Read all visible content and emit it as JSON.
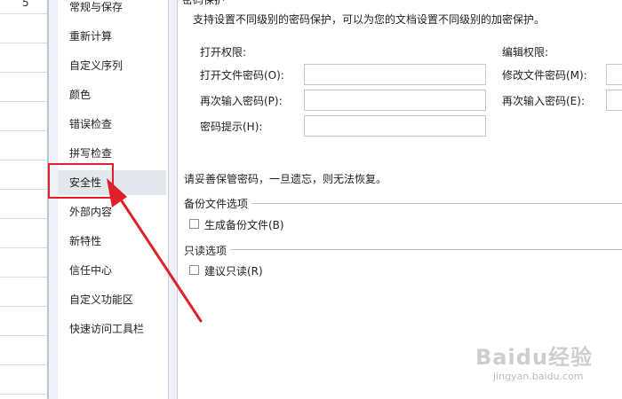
{
  "sheet": {
    "row_value": "5"
  },
  "nav": {
    "items": [
      {
        "label": "常规与保存"
      },
      {
        "label": "重新计算"
      },
      {
        "label": "自定义序列"
      },
      {
        "label": "颜色"
      },
      {
        "label": "错误检查"
      },
      {
        "label": "拼写检查"
      },
      {
        "label": "安全性"
      },
      {
        "label": "外部内容"
      },
      {
        "label": "新特性"
      },
      {
        "label": "信任中心"
      },
      {
        "label": "自定义功能区"
      },
      {
        "label": "快速访问工具栏"
      }
    ],
    "selected_index": 6
  },
  "security": {
    "section_title_partial": "密码保护",
    "description": "支持设置不同级别的密码保护，可以为您的文档设置不同级别的加密保护。",
    "open_permission": {
      "heading": "打开权限:",
      "open_password_label": "打开文件密码(O):",
      "open_password_value": "",
      "reenter_label": "再次输入密码(P):",
      "reenter_value": "",
      "hint_label": "密码提示(H):",
      "hint_value": ""
    },
    "edit_permission": {
      "heading": "编辑权限:",
      "modify_password_label": "修改文件密码(M):",
      "modify_password_value": "",
      "reenter_label": "再次输入密码(E):",
      "reenter_value": ""
    },
    "warning": "请妥善保管密码，一旦遗忘，则无法恢复。",
    "backup": {
      "heading": "备份文件选项",
      "checkbox_label": "生成备份文件(B)",
      "checked": false
    },
    "readonly": {
      "heading": "只读选项",
      "checkbox_label": "建议只读(R)",
      "checked": false
    }
  },
  "annotation": {
    "highlight_color": "#e0202a"
  },
  "watermark": {
    "logo": "Baidu经验",
    "site": "jingyan.baidu.com"
  }
}
